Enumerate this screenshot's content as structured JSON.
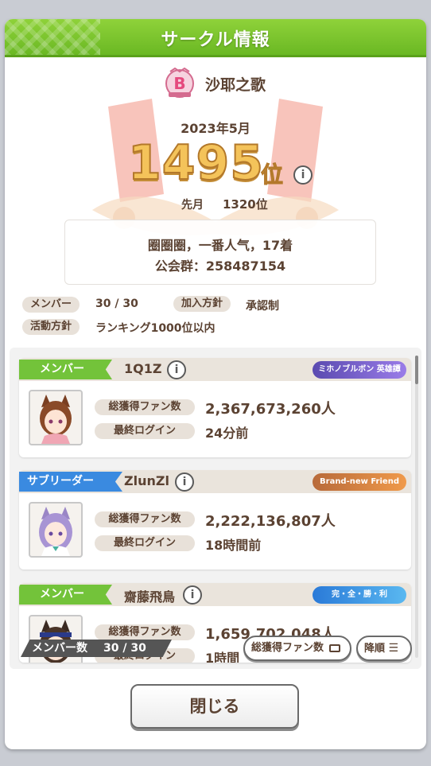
{
  "title": "サークル情報",
  "circle": {
    "emblem_letter": "B",
    "name": "沙耶之歌",
    "month": "2023年5月",
    "rank": "1495",
    "rank_unit": "位",
    "last_month_label": "先月",
    "last_month_value": "1320位",
    "description_line1": "圈圈圈，一番人气，17着",
    "description_line2": "公会群：258487154"
  },
  "meta": {
    "member_label": "メンバー",
    "member_value": "30 / 30",
    "join_label": "加入方針",
    "join_value": "承認制",
    "activity_label": "活動方針",
    "activity_value": "ランキング1000位以内"
  },
  "members": [
    {
      "role": "メンバー",
      "role_color": "#73c33a",
      "name": "1Q1Z",
      "badge": "ミホノブルボン 英雄譚",
      "badge_color": "#7a62c8",
      "fans_label": "総獲得ファン数",
      "fans": "2,367,673,260人",
      "login_label": "最終ログイン",
      "login": "24分前"
    },
    {
      "role": "サブリーダー",
      "role_color": "#3a8ae0",
      "name": "ZlunZl",
      "badge": "Brand-new Friend",
      "badge_color": "#e27a3a",
      "fans_label": "総獲得ファン数",
      "fans": "2,222,136,807人",
      "login_label": "最終ログイン",
      "login": "18時間前"
    },
    {
      "role": "メンバー",
      "role_color": "#73c33a",
      "name": "齋藤飛鳥",
      "badge": "完・全・勝・利",
      "badge_color": "#3a9ae8",
      "fans_label": "総獲得ファン数",
      "fans": "1,659,702,048人",
      "login_label": "最終ログイン",
      "login": "1時間"
    }
  ],
  "footer": {
    "count_label": "メンバー数",
    "count_value": "30 / 30",
    "sort_label": "総獲得ファン数",
    "order_label": "降順",
    "close_label": "閉じる"
  }
}
